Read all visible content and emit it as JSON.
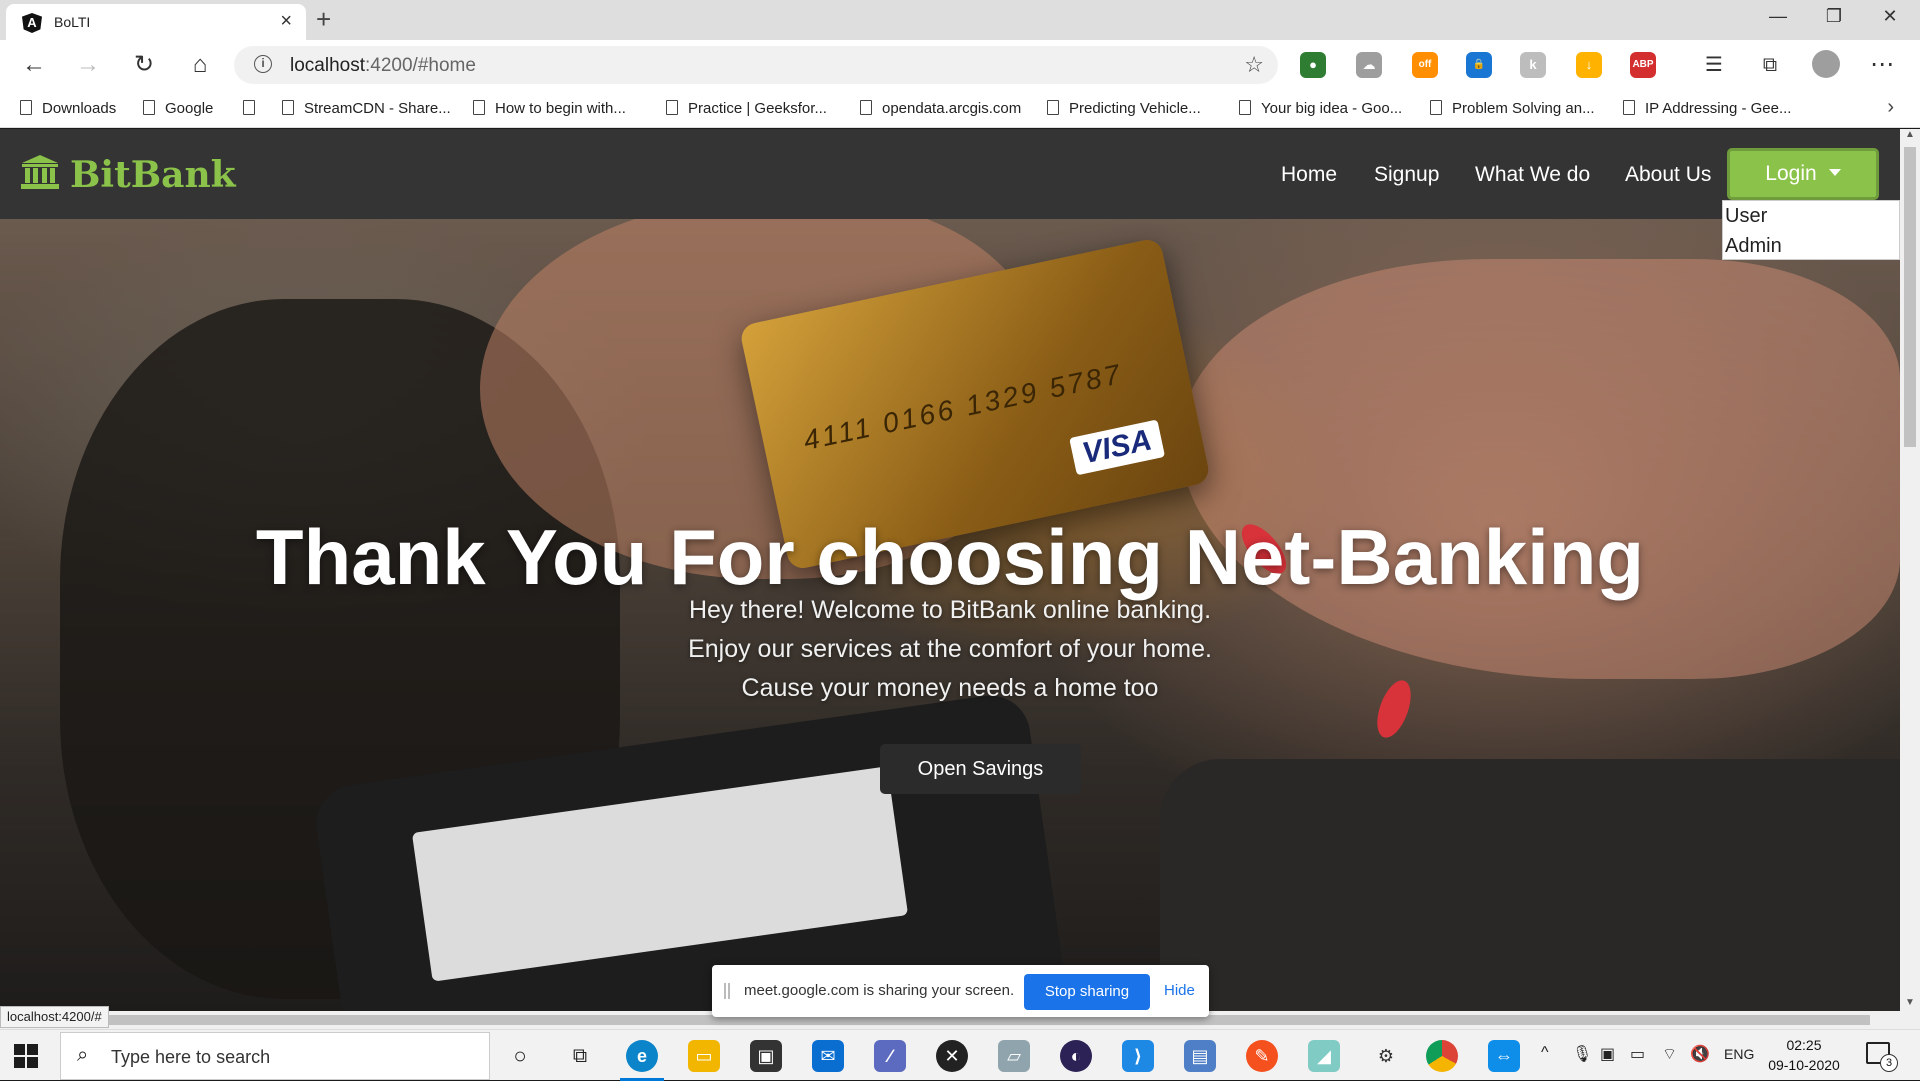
{
  "browser": {
    "tab_title": "BoLTI",
    "tab_icon_letter": "A",
    "url_host": "localhost",
    "url_rest": ":4200/#home",
    "bookmarks": [
      "Downloads",
      "Google",
      "",
      "StreamCDN - Share...",
      "How to begin with...",
      "Practice | Geeksfor...",
      "opendata.arcgis.com",
      "Predicting Vehicle...",
      "Your big idea - Goo...",
      "Problem Solving an...",
      "IP Addressing - Gee..."
    ],
    "extensions": [
      {
        "name": "green-globe-icon",
        "color": "#2e7d32",
        "glyph": "●"
      },
      {
        "name": "cloud-link-icon",
        "color": "#9e9e9e",
        "glyph": "☁"
      },
      {
        "name": "honey-off-icon",
        "color": "#ff8f00",
        "glyph": "off"
      },
      {
        "name": "lock-extension-icon",
        "color": "#1976d2",
        "glyph": "🔒"
      },
      {
        "name": "grey-extension-icon",
        "color": "#bdbdbd",
        "glyph": "k"
      },
      {
        "name": "download-extension-icon",
        "color": "#ffb300",
        "glyph": "↓"
      },
      {
        "name": "adblock-icon",
        "color": "#d32f2f",
        "glyph": "ABP"
      }
    ],
    "status_url": "localhost:4200/#"
  },
  "site": {
    "brand": "BitBank",
    "nav": [
      "Home",
      "Signup",
      "What We do",
      "About Us"
    ],
    "login_label": "Login",
    "login_menu": [
      "User",
      "Admin"
    ],
    "hero_title": "Thank You For choosing Net-Banking",
    "hero_lines": [
      "Hey there! Welcome to BitBank online banking.",
      "Enjoy our services at the comfort of your home.",
      "Cause your money needs a home too"
    ],
    "cta_label": "Open Savings",
    "card_number": "4111 0166 1329 5787",
    "card_brand": "VISA"
  },
  "screen_share": {
    "message": "meet.google.com is sharing your screen.",
    "stop_label": "Stop sharing",
    "hide_label": "Hide"
  },
  "taskbar": {
    "search_placeholder": "Type here to search",
    "language": "ENG",
    "time": "02:25",
    "date": "09-10-2020",
    "notification_count": "3"
  },
  "colors": {
    "brand_green": "#8bc34a",
    "navbar_bg": "#343434",
    "share_blue": "#1a73e8"
  }
}
